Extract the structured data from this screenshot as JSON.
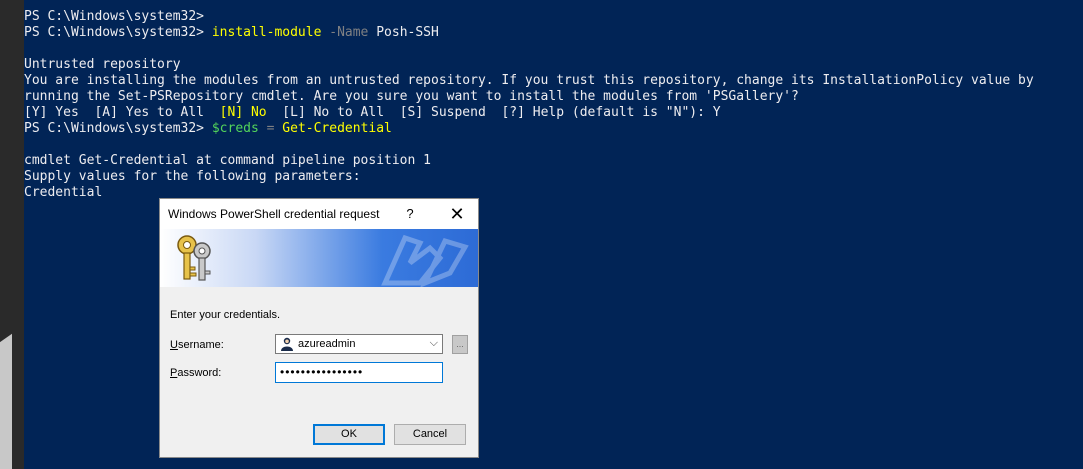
{
  "console": {
    "lines": {
      "l0": "PS C:\\Windows\\system32>",
      "l1_prompt": "PS C:\\Windows\\system32> ",
      "l1_cmd": "install-module",
      "l1_param": " -Name",
      "l1_arg": " Posh-SSH",
      "l3": "Untrusted repository",
      "l4": "You are installing the modules from an untrusted repository. If you trust this repository, change its InstallationPolicy value by",
      "l5": "running the Set-PSRepository cmdlet. Are you sure you want to install the modules from 'PSGallery'?",
      "l6a": "[Y] Yes  [A] Yes to All  ",
      "l6b": "[N] No",
      "l6c": "  [L] No to All  [S] Suspend  [?] Help (default is \"N\"): Y",
      "l7_prompt": "PS C:\\Windows\\system32> ",
      "l7_var": "$creds",
      "l7_eq": " = ",
      "l7_cmd": "Get-Credential",
      "l9": "cmdlet Get-Credential at command pipeline position 1",
      "l10": "Supply values for the following parameters:",
      "l11": "Credential"
    }
  },
  "dialog": {
    "title": "Windows PowerShell credential request",
    "help": "?",
    "close": "✕",
    "prompt": "Enter your credentials.",
    "username_label_first": "U",
    "username_label_rest": "sername:",
    "username_value": "azureadmin",
    "password_label_first": "P",
    "password_label_rest": "assword:",
    "password_value": "••••••••••••••••",
    "browse": "...",
    "combo_arrow": "⌵",
    "ok": "OK",
    "cancel": "Cancel"
  },
  "colors": {
    "console_bg": "#012456",
    "accent": "#0078d7"
  }
}
